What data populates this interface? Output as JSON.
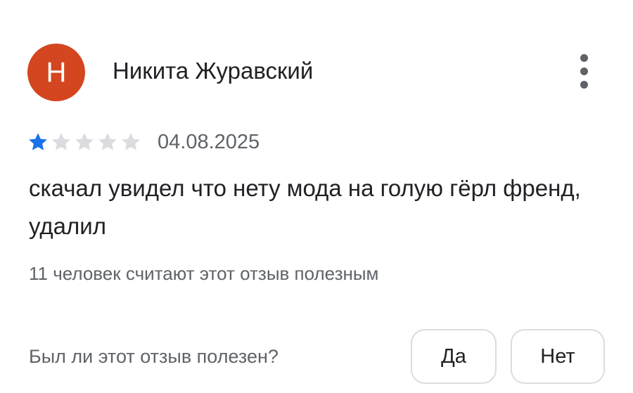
{
  "review": {
    "avatar": {
      "letter": "Н",
      "color": "#d3461f"
    },
    "author": "Никита Журавский",
    "more_icon": "more-vert-icon",
    "rating": {
      "value": 1,
      "max": 5,
      "filled_color": "#1a73e8",
      "empty_color": "#dadce0"
    },
    "date": "04.08.2025",
    "text": "скачал увидел что нету мода на голую гёрл френд, удалил",
    "helpful_count_text": "11 человек считают этот отзыв полезным"
  },
  "feedback": {
    "question": "Был ли этот отзыв полезен?",
    "yes_label": "Да",
    "no_label": "Нет"
  }
}
